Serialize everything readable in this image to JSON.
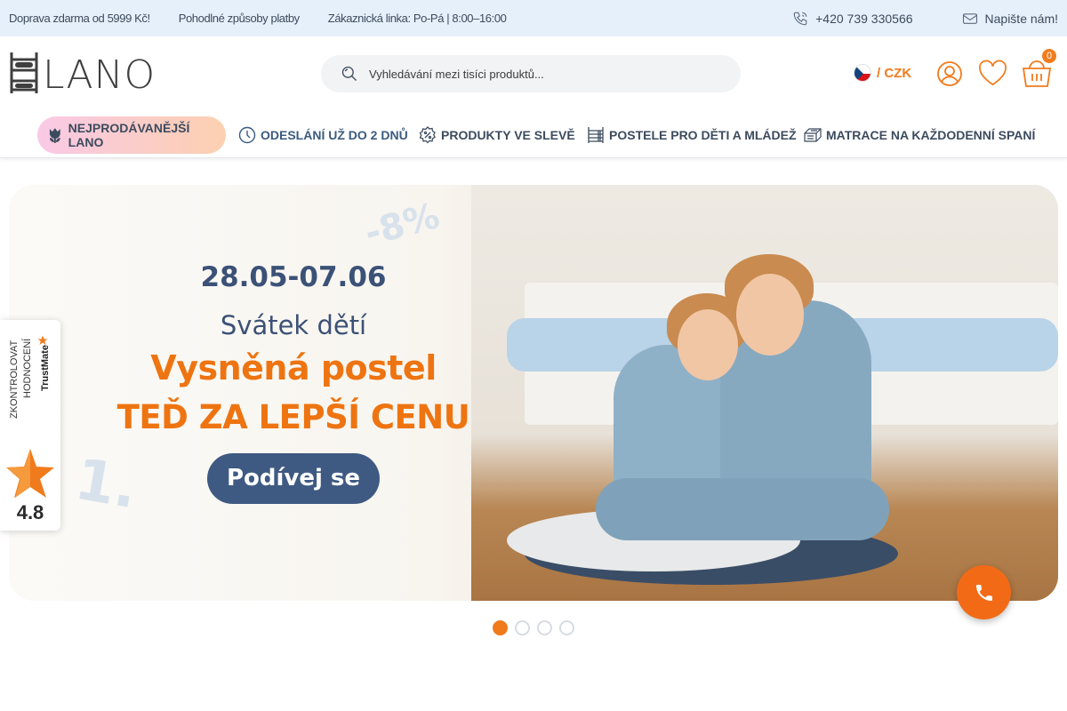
{
  "topbar": {
    "shipping": "Doprava zdarma od 5999 Kč!",
    "payment": "Pohodlné způsoby platby",
    "hotline": "Zákaznická linka: Po-Pá | 8:00–16:00",
    "phone": "+420 739 330566",
    "write_us": "Napište nám!"
  },
  "header": {
    "logo_text": "LANO",
    "search_placeholder": "Vyhledávání mezi tisíci produktů...",
    "currency": "/ CZK",
    "cart_count": "0",
    "icons": [
      "phone-icon",
      "mail-icon",
      "search-icon",
      "czech-flag-icon",
      "user-icon",
      "heart-icon",
      "basket-icon"
    ]
  },
  "nav": {
    "items": [
      {
        "label": "NEJPRODÁVANĚJŠÍ LANO",
        "icon": "tulip-icon"
      },
      {
        "label": "ODESLÁNÍ UŽ DO 2 DNŮ",
        "icon": "clock-icon"
      },
      {
        "label": "PRODUKTY VE SLEVĚ",
        "icon": "percent-badge-icon"
      },
      {
        "label": "POSTELE PRO DĚTI A MLÁDEŽ",
        "icon": "bunk-bed-icon"
      },
      {
        "label": "MATRACE NA KAŽDODENNÍ SPANÍ",
        "icon": "mattress-icon"
      }
    ]
  },
  "banner": {
    "date": "28.05-07.06",
    "subtitle": "Svátek dětí",
    "headline1": "Vysněná postel",
    "headline2": "TEĎ ZA LEPŠÍ CENU",
    "cta": "Podívej se",
    "slides": 4,
    "active_slide": 1
  },
  "trustmate": {
    "line1": "ZKONTROLOVAT",
    "line2": "HODNOCENÍ",
    "brand": "TrustMate",
    "score": "4.8"
  },
  "colors": {
    "accent": "#f07b1d",
    "navy": "#3f5a82",
    "topbar_bg": "#e6f0fb"
  }
}
